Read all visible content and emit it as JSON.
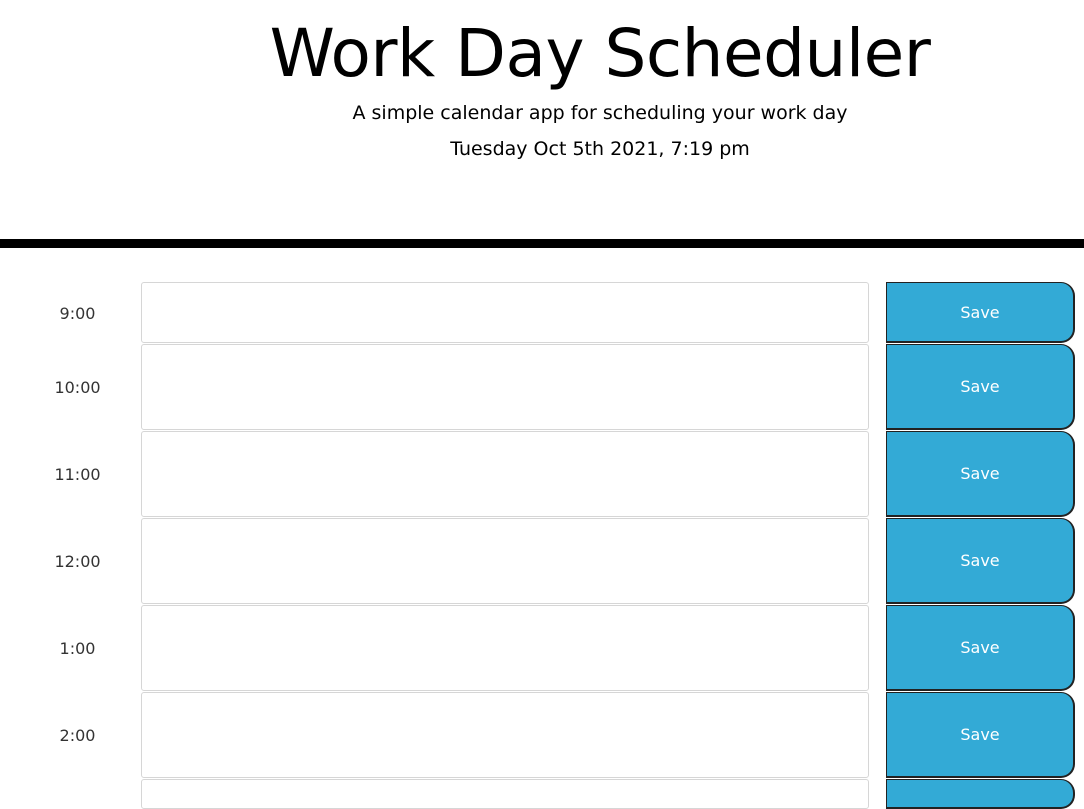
{
  "header": {
    "title": "Work Day Scheduler",
    "lead": "A simple calendar app for scheduling your work day",
    "current_day": "Tuesday Oct 5th 2021, 7:19 pm"
  },
  "time_blocks": [
    {
      "hour": "9:00",
      "text": "",
      "save_label": "Save"
    },
    {
      "hour": "10:00",
      "text": "",
      "save_label": "Save"
    },
    {
      "hour": "11:00",
      "text": "",
      "save_label": "Save"
    },
    {
      "hour": "12:00",
      "text": "",
      "save_label": "Save"
    },
    {
      "hour": "1:00",
      "text": "",
      "save_label": "Save"
    },
    {
      "hour": "2:00",
      "text": "",
      "save_label": "Save"
    },
    {
      "hour": "",
      "text": "",
      "save_label": ""
    }
  ],
  "colors": {
    "save_button": "#33aad6",
    "divider": "#000000"
  }
}
